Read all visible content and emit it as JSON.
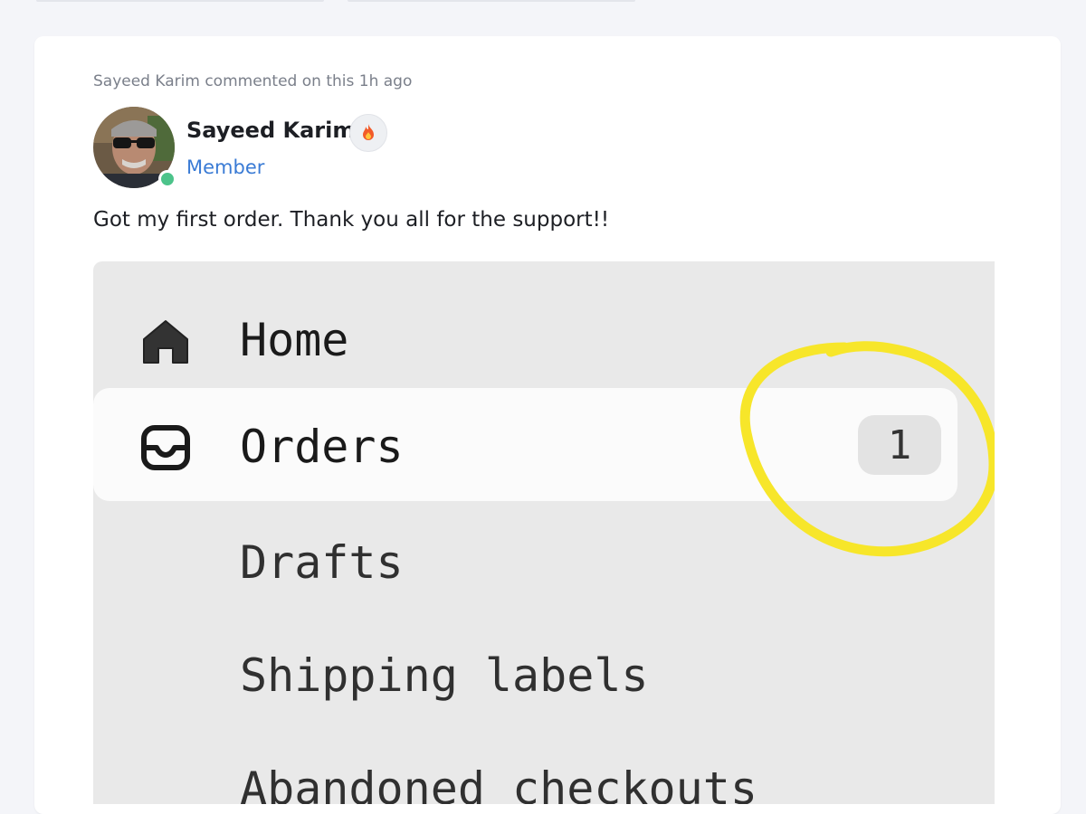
{
  "post": {
    "meta": "Sayeed Karim commented on this 1h ago",
    "author": {
      "name": "Sayeed Karim",
      "role": "Member",
      "badge_icon": "fire-icon",
      "online": true,
      "avatar": "avatar-photo"
    },
    "text": "Got my first order. Thank you all for the support!!"
  },
  "attachment": {
    "nav": [
      {
        "label": "Home",
        "icon": "home-icon"
      },
      {
        "label": "Orders",
        "icon": "inbox-icon",
        "count": "1",
        "active": true
      },
      {
        "label": "Drafts"
      },
      {
        "label": "Shipping labels"
      },
      {
        "label": "Abandoned checkouts"
      }
    ],
    "annotation_color": "#f7e62a"
  },
  "colors": {
    "background": "#f4f5f9",
    "card": "#ffffff",
    "role_link": "#3a7bd5",
    "online": "#4cc38a"
  }
}
